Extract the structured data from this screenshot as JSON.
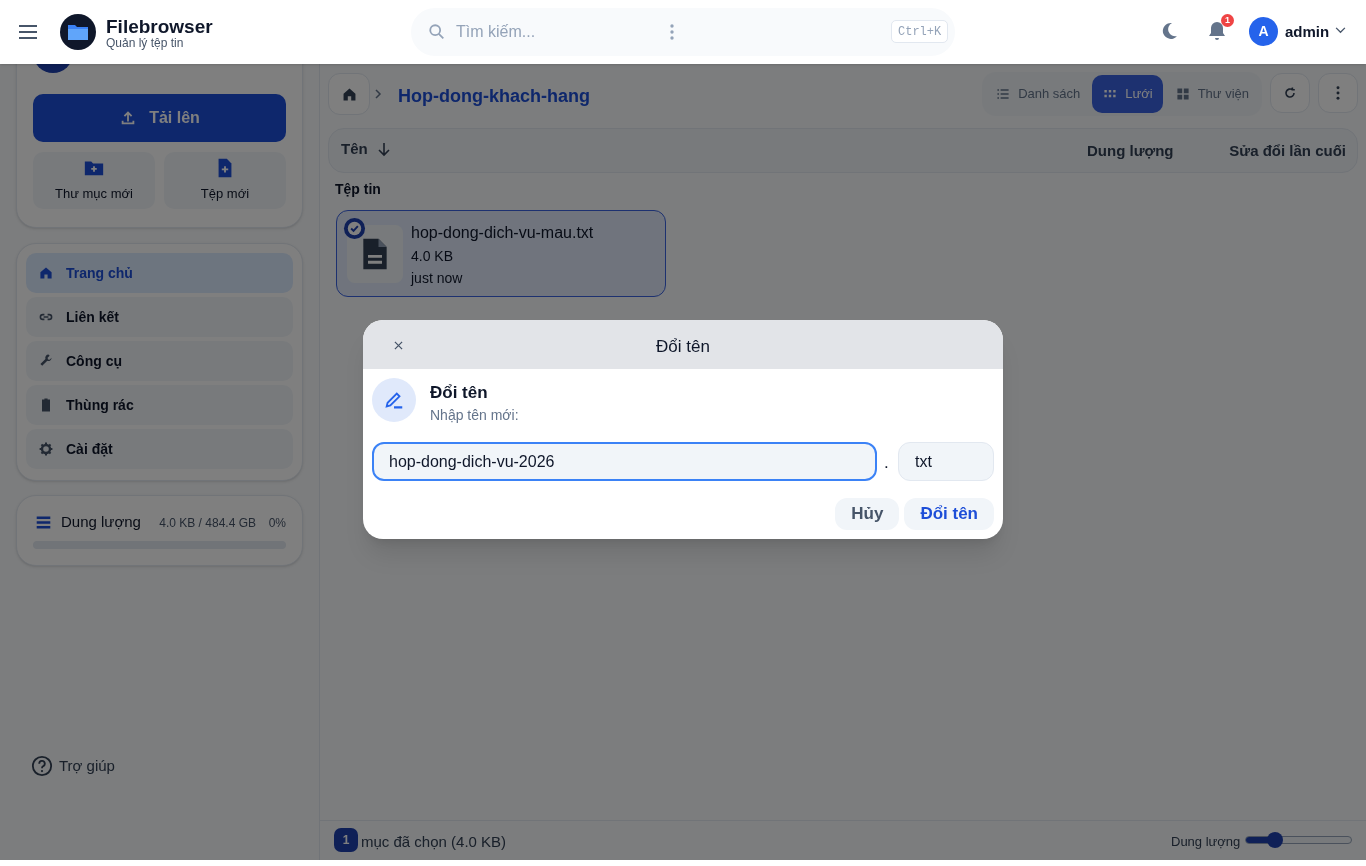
{
  "header": {
    "app_title": "Filebrowser",
    "app_subtitle": "Quản lý tệp tin",
    "search": {
      "placeholder": "Tìm kiếm...",
      "shortcut": "Ctrl+K"
    },
    "notifications": "1",
    "user": {
      "initial": "A",
      "name": "admin"
    }
  },
  "sidebar": {
    "upload": "Tải lên",
    "actions": [
      {
        "label": "Thư mục mới",
        "kind": "folder"
      },
      {
        "label": "Tệp mới",
        "kind": "file"
      }
    ],
    "nav": [
      {
        "label": "Trang chủ",
        "selected": true
      },
      {
        "label": "Liên kết",
        "selected": false
      },
      {
        "label": "Công cụ",
        "selected": false
      },
      {
        "label": "Thùng rác",
        "selected": false
      },
      {
        "label": "Cài đặt",
        "selected": false
      }
    ],
    "storage": {
      "label": "Dung lượng",
      "usage": "4.0 KB / 484.4 GB",
      "percent": "0%"
    },
    "help": "Trợ giúp"
  },
  "main": {
    "breadcrumb": "Hop-dong-khach-hang",
    "views": [
      {
        "label": "Danh sách",
        "selected": false
      },
      {
        "label": "Lưới",
        "selected": true
      },
      {
        "label": "Thư viện",
        "selected": false
      }
    ],
    "columns": [
      "Tên",
      "Dung lượng",
      "Sửa đổi lần cuối"
    ],
    "section": "Tệp tin",
    "files": [
      {
        "name": "hop-dong-dich-vu-mau.txt",
        "size": "4.0 KB",
        "modified": "just now",
        "selected": true
      }
    ],
    "status": {
      "count": "1",
      "text": "mục đã chọn (4.0 KB)",
      "size_label": "Dung lượng",
      "slider": {
        "level": 0.28
      }
    }
  },
  "dialog": {
    "title": "Đổi tên",
    "heading": "Đổi tên",
    "prompt": "Nhập tên mới:",
    "name_value": "hop-dong-dich-vu-2026",
    "separator": ".",
    "extension": "txt",
    "buttons": [
      {
        "label": "Hủy",
        "kind": "cancel"
      },
      {
        "label": "Đổi tên",
        "kind": "primary"
      }
    ]
  }
}
